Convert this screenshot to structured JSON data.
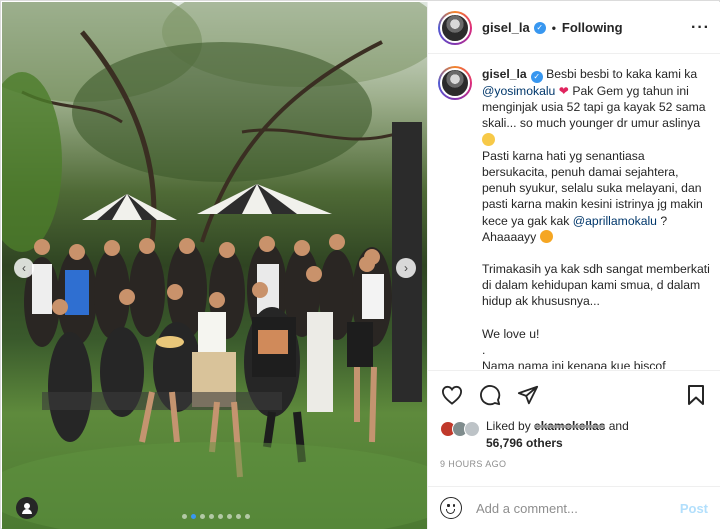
{
  "post": {
    "username": "gisel_la",
    "verified_glyph": "✓",
    "separator": "•",
    "follow_label": "Following",
    "more_label": "···"
  },
  "caption": {
    "line1": " Besbi besbi to kaka kami ka ",
    "mention1": "@yosimokalu",
    "heart": "❤",
    "line2": " Pak Gem yg tahun ini menginjak usia 52 tapi ga kayak 52 sama skali... so much younger dr umur aslinya",
    "line3": "Pasti karna hati yg senantiasa bersukacita, penuh damai sejahtera, penuh syukur, selalu suka melayani, dan pasti karna makin kesini istrinya jg makin kece ya gak kak ",
    "mention2": "@aprillamokalu",
    "line4": " ? Ahaaaayy",
    "line5": "Trimakasih ya kak sdh sangat memberkati di dalam kehidupan kami smua, d dalam hidup ak khususnya...",
    "line6": "We love u!",
    "line7": ".",
    "line8": "Nama nama ini kenapa kue biscof"
  },
  "likes": {
    "prefix": "Liked by ",
    "user": "ekamokellas",
    "connector": " and",
    "count": "56,796 others"
  },
  "time": "9 HOURS AGO",
  "comment": {
    "placeholder": "Add a comment...",
    "post_label": "Post"
  },
  "carousel": {
    "prev": "‹",
    "next": "›",
    "slide_count": 8,
    "active_index": 1
  },
  "icons": {
    "like": "heart-icon",
    "comment": "comment-icon",
    "share": "paper-plane-icon",
    "save": "bookmark-icon",
    "emoji": "smile-icon",
    "tag": "user-tag-icon"
  },
  "colors": {
    "accent_blue": "#3897f0",
    "mention": "#00376b",
    "post_disabled": "#b2dffc",
    "heart": "#e0245e"
  }
}
